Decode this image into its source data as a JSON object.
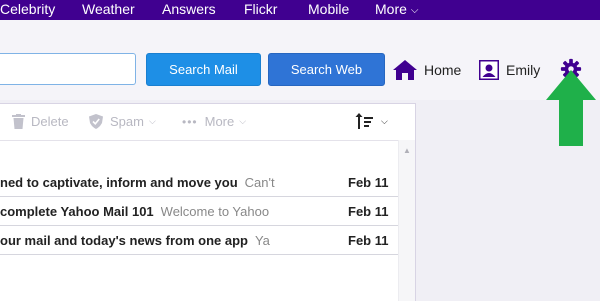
{
  "topnav": {
    "items": [
      "Celebrity",
      "Weather",
      "Answers",
      "Flickr",
      "Mobile",
      "More"
    ],
    "background": "#400090"
  },
  "header": {
    "search_mail_label": "Search Mail",
    "search_web_label": "Search Web",
    "home_label": "Home",
    "user_name": "Emily"
  },
  "toolbar": {
    "delete_label": "Delete",
    "spam_label": "Spam",
    "more_label": "More"
  },
  "messages": [
    {
      "subject": "ned to captivate, inform and move you",
      "snippet": "Can't",
      "date": "Feb 11"
    },
    {
      "subject": "complete Yahoo Mail 101",
      "snippet": "Welcome to Yahoo",
      "date": "Feb 11"
    },
    {
      "subject": "our mail and today's news from one app",
      "snippet": "Ya",
      "date": "Feb 11"
    }
  ],
  "colors": {
    "brand_purple": "#400090",
    "search_mail_blue": "#1e8fe6",
    "search_web_blue": "#2f74d6",
    "arrow_green": "#1fb04a"
  },
  "icons": {
    "home": "home-icon",
    "user": "user-icon",
    "settings": "gear-icon",
    "delete": "trash-icon",
    "spam": "shield-icon",
    "more": "ellipsis-icon",
    "sort": "sort-icon"
  }
}
